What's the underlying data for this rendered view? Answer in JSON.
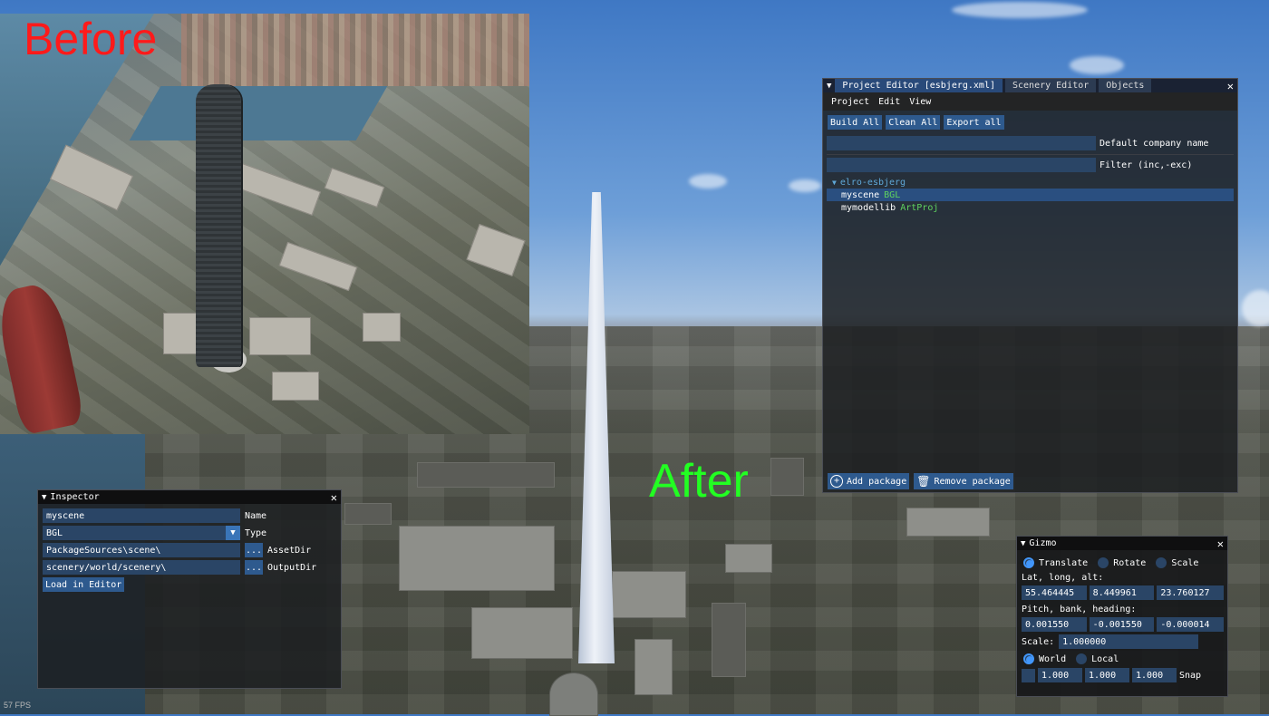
{
  "overlay": {
    "before_label": "Before",
    "after_label": "After",
    "fps": "57 FPS"
  },
  "project_editor": {
    "tabs": [
      "Project Editor [esbjerg.xml]",
      "Scenery Editor",
      "Objects"
    ],
    "menu": [
      "Project",
      "Edit",
      "View"
    ],
    "buttons": {
      "build_all": "Build All",
      "clean_all": "Clean All",
      "export_all": "Export all"
    },
    "company_name_label": "Default company name",
    "company_name_value": "",
    "filter_label": "Filter (inc,-exc)",
    "filter_value": "",
    "tree": {
      "root": "elro-esbjerg",
      "packages": [
        {
          "name": "myscene",
          "type": "BGL",
          "selected": true
        },
        {
          "name": "mymodellib",
          "type": "ArtProj",
          "selected": false
        }
      ]
    },
    "add_package": "Add package",
    "remove_package": "Remove package",
    "type_colors": {
      "BGL": "#5fd35f",
      "ArtProj": "#5fd35f"
    }
  },
  "inspector": {
    "title": "Inspector",
    "rows": {
      "name": {
        "value": "myscene",
        "label": "Name"
      },
      "type": {
        "value": "BGL",
        "label": "Type"
      },
      "asset_dir": {
        "value": "PackageSources\\scene\\",
        "label": "AssetDir",
        "browse": "..."
      },
      "output_dir": {
        "value": "scenery/world/scenery\\",
        "label": "OutputDir",
        "browse": "..."
      }
    },
    "load_button": "Load in Editor"
  },
  "gizmo": {
    "title": "Gizmo",
    "modes": [
      {
        "label": "Translate",
        "selected": true
      },
      {
        "label": "Rotate",
        "selected": false
      },
      {
        "label": "Scale",
        "selected": false
      }
    ],
    "lat_long_alt_label": "Lat, long, alt:",
    "lat_long_alt": [
      "55.464445",
      "8.449961",
      "23.760127"
    ],
    "pbh_label": "Pitch, bank, heading:",
    "pbh": [
      "0.001550",
      "-0.001550",
      "-0.000014"
    ],
    "scale_label": "Scale:",
    "scale_value": "1.000000",
    "space": [
      {
        "label": "World",
        "selected": true
      },
      {
        "label": "Local",
        "selected": false
      }
    ],
    "snap_values": [
      "1.000",
      "1.000",
      "1.000"
    ],
    "snap_label": "Snap"
  },
  "colors": {
    "accent": "#4296fa",
    "title_active": "#2b4a7a",
    "field_bg": "#2a4566",
    "button_bg": "#2e5a8e",
    "selected_row": "#2a4f80",
    "tree_root": "#5fa8d8"
  }
}
